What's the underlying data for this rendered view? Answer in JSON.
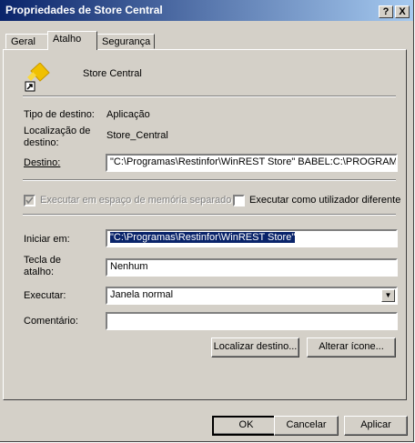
{
  "window": {
    "title": "Propriedades de Store Central",
    "help_label": "?",
    "close_label": "X"
  },
  "tabs": [
    {
      "label": "Geral"
    },
    {
      "label": "Atalho"
    },
    {
      "label": "Segurança"
    }
  ],
  "shortcut": {
    "name": "Store Central",
    "target_type_label": "Tipo de destino:",
    "target_type_value": "Aplicação",
    "target_location_label_1": "Localização de",
    "target_location_label_2": "destino:",
    "target_location_value": "Store_Central",
    "target_label": "Destino:",
    "target_value": "\"C:\\Programas\\Restinfor\\WinREST Store\" BABEL:C:\\PROGRAM,",
    "separate_memory_label": "Executar em espaço de memória separado",
    "run_as_other_label": "Executar como utilizador diferente",
    "start_in_label": "Iniciar em:",
    "start_in_value": "\"C:\\Programas\\Restinfor\\WinREST Store\"",
    "hotkey_label_1": "Tecla de",
    "hotkey_label_2": "atalho:",
    "hotkey_value": "Nenhum",
    "run_label": "Executar:",
    "run_value": "Janela normal",
    "comment_label": "Comentário:",
    "comment_value": "",
    "find_target_label": "Localizar destino...",
    "change_icon_label": "Alterar ícone..."
  },
  "footer": {
    "ok_label": "OK",
    "cancel_label": "Cancelar",
    "apply_label": "Aplicar"
  }
}
